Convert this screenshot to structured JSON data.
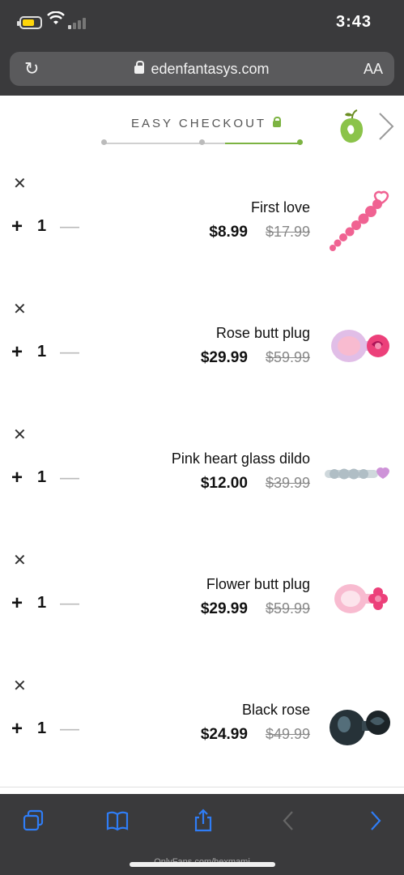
{
  "status_bar": {
    "time": "3:43"
  },
  "browser": {
    "url": "edenfantasys.com",
    "text_size_label": "AA"
  },
  "checkout": {
    "label": "EASY CHECKOUT",
    "accent_color": "#7cb342",
    "steps_total": 3,
    "step_current": 3
  },
  "cart": {
    "items": [
      {
        "name": "First love",
        "price": "$8.99",
        "old_price": "$17.99",
        "quantity": "1",
        "thumb": "pink-anal-beads-image"
      },
      {
        "name": "Rose butt plug",
        "price": "$29.99",
        "old_price": "$59.99",
        "quantity": "1",
        "thumb": "pink-rose-plug-image"
      },
      {
        "name": "Pink heart glass dildo",
        "price": "$12.00",
        "old_price": "$39.99",
        "quantity": "1",
        "thumb": "glass-dildo-image"
      },
      {
        "name": "Flower butt plug",
        "price": "$29.99",
        "old_price": "$59.99",
        "quantity": "1",
        "thumb": "pink-flower-plug-image"
      },
      {
        "name": "Black rose",
        "price": "$24.99",
        "old_price": "$49.99",
        "quantity": "1",
        "thumb": "black-rose-plug-image"
      }
    ],
    "remove_symbol": "✕",
    "plus_symbol": "+",
    "minus_symbol": "—"
  },
  "watermark": "OnlyFans.com/hexmami"
}
